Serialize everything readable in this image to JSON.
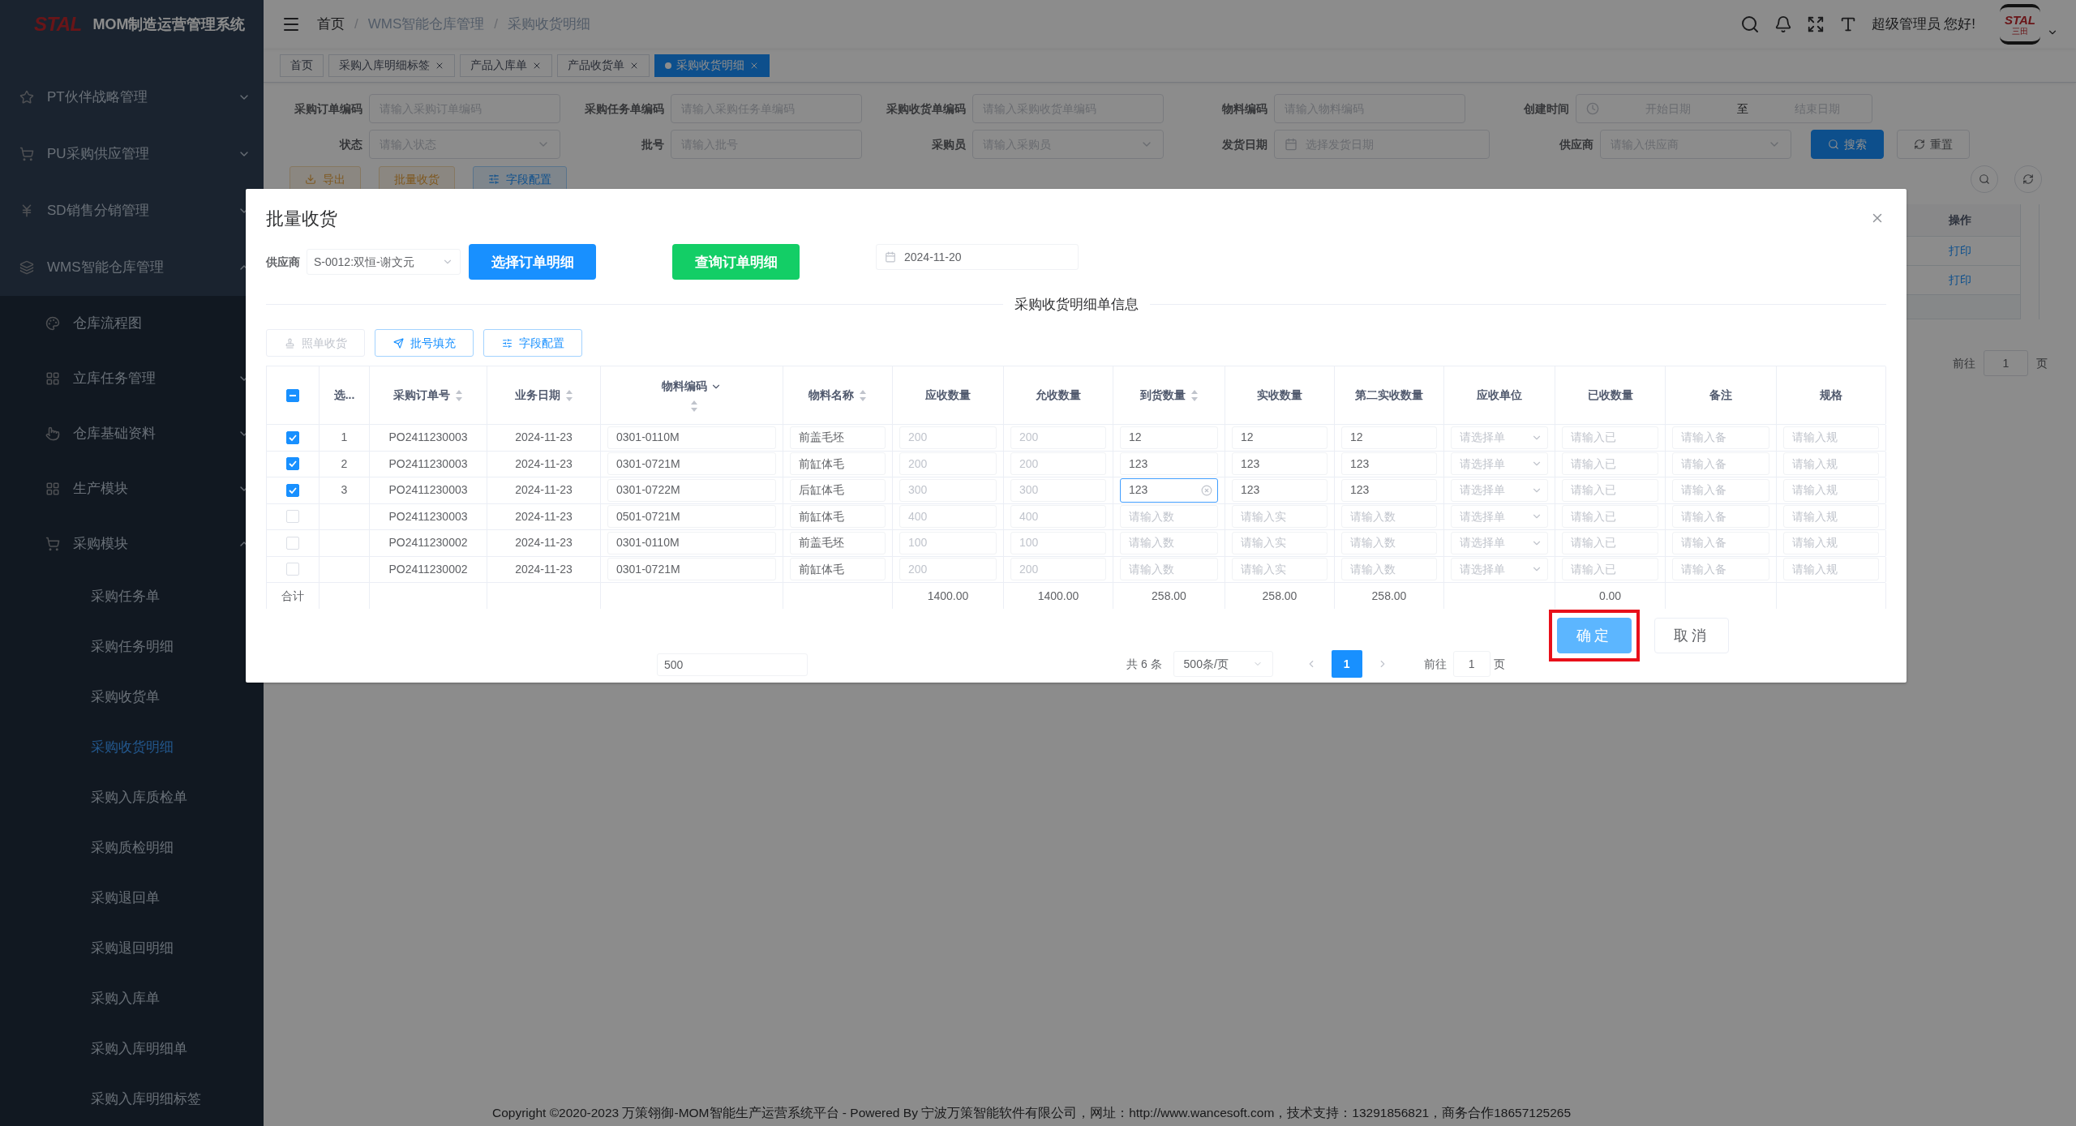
{
  "sidebar": {
    "logo": "STAL",
    "title": "MOM制造运营管理系统",
    "items": [
      {
        "label": "PT伙伴战略管理",
        "expanded": false
      },
      {
        "label": "PU采购供应管理",
        "expanded": false
      },
      {
        "label": "SD销售分销管理",
        "expanded": false
      },
      {
        "label": "WMS智能仓库管理",
        "expanded": true,
        "children": [
          {
            "label": "仓库流程图",
            "selected": false
          },
          {
            "label": "立库任务管理",
            "expanded": false
          },
          {
            "label": "仓库基础资料",
            "expanded": false
          },
          {
            "label": "生产模块",
            "expanded": false
          },
          {
            "label": "采购模块",
            "expanded": true,
            "children": [
              {
                "label": "采购任务单",
                "selected": false
              },
              {
                "label": "采购任务明细",
                "selected": false
              },
              {
                "label": "采购收货单",
                "selected": false
              },
              {
                "label": "采购收货明细",
                "selected": true
              },
              {
                "label": "采购入库质检单",
                "selected": false
              },
              {
                "label": "采购质检明细",
                "selected": false
              },
              {
                "label": "采购退回单",
                "selected": false
              },
              {
                "label": "采购退回明细",
                "selected": false
              },
              {
                "label": "采购入库单",
                "selected": false
              },
              {
                "label": "采购入库明细单",
                "selected": false
              },
              {
                "label": "采购入库明细标签",
                "selected": false
              }
            ]
          }
        ]
      }
    ]
  },
  "header": {
    "breadcrumb": [
      "首页",
      "WMS智能仓库管理",
      "采购收货明细"
    ],
    "breadcrumb_separator": "/",
    "greeting": "超级管理员 您好!",
    "avatar": {
      "logo": "STAL",
      "subtitle": "三田"
    }
  },
  "tabs": [
    {
      "label": "首页",
      "selected": false,
      "closable": false
    },
    {
      "label": "采购入库明细标签",
      "selected": false,
      "closable": true
    },
    {
      "label": "产品入库单",
      "selected": false,
      "closable": true
    },
    {
      "label": "产品收货单",
      "selected": false,
      "closable": true
    },
    {
      "label": "采购收货明细",
      "selected": true,
      "closable": true
    }
  ],
  "filter_rows": [
    [
      {
        "label": "采购订单编码",
        "kind": "text",
        "placeholder": "请输入采购订单编码"
      },
      {
        "label": "采购任务单编码",
        "kind": "text",
        "placeholder": "请输入采购任务单编码"
      },
      {
        "label": "采购收货单编码",
        "kind": "text",
        "placeholder": "请输入采购收货单编码"
      },
      {
        "label": "物料编码",
        "kind": "text",
        "placeholder": "请输入物料编码"
      },
      {
        "label": "创建时间",
        "kind": "range",
        "start": "开始日期",
        "separator": "至",
        "end": "结束日期"
      }
    ],
    [
      {
        "label": "状态",
        "kind": "select",
        "placeholder": "请输入状态"
      },
      {
        "label": "批号",
        "kind": "text",
        "placeholder": "请输入批号"
      },
      {
        "label": "采购员",
        "kind": "select",
        "placeholder": "请输入采购员"
      },
      {
        "label": "发货日期",
        "kind": "date",
        "placeholder": "选择发货日期"
      },
      {
        "label": "供应商",
        "kind": "select",
        "placeholder": "请输入供应商"
      }
    ]
  ],
  "filter_buttons": [
    {
      "label": "搜索",
      "kind": "primary"
    },
    {
      "label": "重置",
      "kind": "plain"
    }
  ],
  "actions": [
    {
      "label": "导出",
      "kind": "warning"
    },
    {
      "label": "批量收货",
      "kind": "warning"
    },
    {
      "label": "字段配置",
      "kind": "info"
    }
  ],
  "background_table": {
    "column": "操作",
    "rows": [
      "打印",
      "打印"
    ]
  },
  "background_pagination": {
    "goto": "前往",
    "page": "1",
    "unit": "页"
  },
  "dialog": {
    "title": "批量收货",
    "supplier_label": "供应商",
    "supplier": "S-0012:双恒-谢文元",
    "buttons": [
      {
        "label": "选择订单明细",
        "kind": "primary"
      },
      {
        "label": "查询订单明细",
        "kind": "success"
      }
    ],
    "date": "2024-11-20",
    "section_title": "采购收货明细单信息",
    "toolbar": [
      {
        "label": "照单收货",
        "disabled": true
      },
      {
        "label": "批号填充",
        "disabled": false
      },
      {
        "label": "字段配置",
        "disabled": false
      }
    ],
    "table": {
      "select_all": {
        "checked": true,
        "indeterminate": true
      },
      "total_label": "合计",
      "columns": [
        {
          "label": "选...",
          "sortable": false,
          "filterable": false
        },
        {
          "label": "采购订单号",
          "sortable": true,
          "filterable": false
        },
        {
          "label": "业务日期",
          "sortable": true,
          "filterable": false
        },
        {
          "label": "物料编码",
          "sortable": true,
          "filterable": true
        },
        {
          "label": "物料名称",
          "sortable": true,
          "filterable": false
        },
        {
          "label": "应收数量",
          "sortable": false,
          "filterable": false,
          "total": "1400.00"
        },
        {
          "label": "允收数量",
          "sortable": false,
          "filterable": false,
          "total": "1400.00"
        },
        {
          "label": "到货数量",
          "sortable": true,
          "filterable": false,
          "total": "258.00"
        },
        {
          "label": "实收数量",
          "sortable": false,
          "filterable": false,
          "total": "258.00"
        },
        {
          "label": "第二实收数量",
          "sortable": false,
          "filterable": false,
          "total": "258.00"
        },
        {
          "label": "应收单位",
          "sortable": false,
          "filterable": false
        },
        {
          "label": "已收数量",
          "sortable": false,
          "filterable": false,
          "total": "0.00"
        },
        {
          "label": "备注",
          "sortable": false,
          "filterable": false
        },
        {
          "label": "规格",
          "sortable": false,
          "filterable": false
        }
      ],
      "rows": [
        {
          "checked": true,
          "cells": [
            {
              "kind": "plain",
              "value": "1"
            },
            {
              "kind": "plain",
              "value": "PO2411230003"
            },
            {
              "kind": "plain",
              "value": "2024-11-23"
            },
            {
              "kind": "text",
              "value": "0301-0110M"
            },
            {
              "kind": "text",
              "value": "前盖毛坯"
            },
            {
              "kind": "readonly",
              "value": "200"
            },
            {
              "kind": "readonly",
              "value": "200"
            },
            {
              "kind": "text",
              "value": "12"
            },
            {
              "kind": "text",
              "value": "12"
            },
            {
              "kind": "text",
              "value": "12"
            },
            {
              "kind": "select",
              "placeholder": "请选择单"
            },
            {
              "kind": "text",
              "placeholder": "请输入已"
            },
            {
              "kind": "text",
              "placeholder": "请输入备"
            },
            {
              "kind": "text",
              "placeholder": "请输入规"
            }
          ]
        },
        {
          "checked": true,
          "cells": [
            {
              "kind": "plain",
              "value": "2"
            },
            {
              "kind": "plain",
              "value": "PO2411230003"
            },
            {
              "kind": "plain",
              "value": "2024-11-23"
            },
            {
              "kind": "text",
              "value": "0301-0721M"
            },
            {
              "kind": "text",
              "value": "前缸体毛"
            },
            {
              "kind": "readonly",
              "value": "200"
            },
            {
              "kind": "readonly",
              "value": "200"
            },
            {
              "kind": "text",
              "value": "123"
            },
            {
              "kind": "text",
              "value": "123"
            },
            {
              "kind": "text",
              "value": "123"
            },
            {
              "kind": "select",
              "placeholder": "请选择单"
            },
            {
              "kind": "text",
              "placeholder": "请输入已"
            },
            {
              "kind": "text",
              "placeholder": "请输入备"
            },
            {
              "kind": "text",
              "placeholder": "请输入规"
            }
          ]
        },
        {
          "checked": true,
          "cells": [
            {
              "kind": "plain",
              "value": "3"
            },
            {
              "kind": "plain",
              "value": "PO2411230003"
            },
            {
              "kind": "plain",
              "value": "2024-11-23"
            },
            {
              "kind": "text",
              "value": "0301-0722M"
            },
            {
              "kind": "text",
              "value": "后缸体毛"
            },
            {
              "kind": "readonly",
              "value": "300"
            },
            {
              "kind": "readonly",
              "value": "300"
            },
            {
              "kind": "focused",
              "value": "123"
            },
            {
              "kind": "text",
              "value": "123"
            },
            {
              "kind": "text",
              "value": "123"
            },
            {
              "kind": "select",
              "placeholder": "请选择单"
            },
            {
              "kind": "text",
              "placeholder": "请输入已"
            },
            {
              "kind": "text",
              "placeholder": "请输入备"
            },
            {
              "kind": "text",
              "placeholder": "请输入规"
            }
          ]
        },
        {
          "checked": false,
          "cells": [
            {
              "kind": "plain"
            },
            {
              "kind": "plain",
              "value": "PO2411230003"
            },
            {
              "kind": "plain",
              "value": "2024-11-23"
            },
            {
              "kind": "text",
              "value": "0501-0721M"
            },
            {
              "kind": "text",
              "value": "前缸体毛"
            },
            {
              "kind": "readonly",
              "value": "400"
            },
            {
              "kind": "readonly",
              "value": "400"
            },
            {
              "kind": "text",
              "placeholder": "请输入数"
            },
            {
              "kind": "text",
              "placeholder": "请输入实"
            },
            {
              "kind": "text",
              "placeholder": "请输入数"
            },
            {
              "kind": "select",
              "placeholder": "请选择单"
            },
            {
              "kind": "text",
              "placeholder": "请输入已"
            },
            {
              "kind": "text",
              "placeholder": "请输入备"
            },
            {
              "kind": "text",
              "placeholder": "请输入规"
            }
          ]
        },
        {
          "checked": false,
          "cells": [
            {
              "kind": "plain"
            },
            {
              "kind": "plain",
              "value": "PO2411230002"
            },
            {
              "kind": "plain",
              "value": "2024-11-23"
            },
            {
              "kind": "text",
              "value": "0301-0110M"
            },
            {
              "kind": "text",
              "value": "前盖毛坯"
            },
            {
              "kind": "readonly",
              "value": "100"
            },
            {
              "kind": "readonly",
              "value": "100"
            },
            {
              "kind": "text",
              "placeholder": "请输入数"
            },
            {
              "kind": "text",
              "placeholder": "请输入实"
            },
            {
              "kind": "text",
              "placeholder": "请输入数"
            },
            {
              "kind": "select",
              "placeholder": "请选择单"
            },
            {
              "kind": "text",
              "placeholder": "请输入已"
            },
            {
              "kind": "text",
              "placeholder": "请输入备"
            },
            {
              "kind": "text",
              "placeholder": "请输入规"
            }
          ]
        },
        {
          "checked": false,
          "cells": [
            {
              "kind": "plain"
            },
            {
              "kind": "plain",
              "value": "PO2411230002"
            },
            {
              "kind": "plain",
              "value": "2024-11-23"
            },
            {
              "kind": "text",
              "value": "0301-0721M"
            },
            {
              "kind": "text",
              "value": "前缸体毛"
            },
            {
              "kind": "readonly",
              "value": "200"
            },
            {
              "kind": "readonly",
              "value": "200"
            },
            {
              "kind": "text",
              "placeholder": "请输入数"
            },
            {
              "kind": "text",
              "placeholder": "请输入实"
            },
            {
              "kind": "text",
              "placeholder": "请输入数"
            },
            {
              "kind": "select",
              "placeholder": "请选择单"
            },
            {
              "kind": "text",
              "placeholder": "请输入已"
            },
            {
              "kind": "text",
              "placeholder": "请输入备"
            },
            {
              "kind": "text",
              "placeholder": "请输入规"
            }
          ]
        }
      ]
    },
    "bottom_input": "500",
    "pagination": {
      "total": "共 6 条",
      "page_size": "500条/页",
      "pages": [
        {
          "label": "1",
          "selected": true
        }
      ],
      "goto": "前往",
      "page": "1",
      "unit": "页"
    },
    "footer_buttons": [
      {
        "label": "确定",
        "kind": "primary",
        "highlighted": true
      },
      {
        "label": "取消",
        "kind": "plain",
        "highlighted": false
      }
    ]
  },
  "footer": "Copyright ©2020-2023 万策翎御-MOM智能生产运营系统平台 - Powered By 宁波万策智能软件有限公司，网址：http://www.wancesoft.com，技术支持：13291856821，商务合作18657125265"
}
